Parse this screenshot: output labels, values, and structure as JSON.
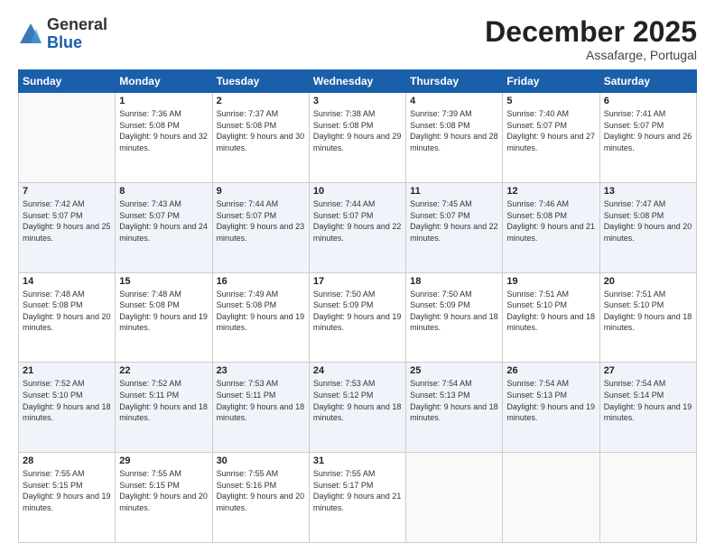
{
  "logo": {
    "general": "General",
    "blue": "Blue"
  },
  "header": {
    "month": "December 2025",
    "location": "Assafarge, Portugal"
  },
  "days_of_week": [
    "Sunday",
    "Monday",
    "Tuesday",
    "Wednesday",
    "Thursday",
    "Friday",
    "Saturday"
  ],
  "weeks": [
    [
      {
        "day": "",
        "sunrise": "",
        "sunset": "",
        "daylight": ""
      },
      {
        "day": "1",
        "sunrise": "Sunrise: 7:36 AM",
        "sunset": "Sunset: 5:08 PM",
        "daylight": "Daylight: 9 hours and 32 minutes."
      },
      {
        "day": "2",
        "sunrise": "Sunrise: 7:37 AM",
        "sunset": "Sunset: 5:08 PM",
        "daylight": "Daylight: 9 hours and 30 minutes."
      },
      {
        "day": "3",
        "sunrise": "Sunrise: 7:38 AM",
        "sunset": "Sunset: 5:08 PM",
        "daylight": "Daylight: 9 hours and 29 minutes."
      },
      {
        "day": "4",
        "sunrise": "Sunrise: 7:39 AM",
        "sunset": "Sunset: 5:08 PM",
        "daylight": "Daylight: 9 hours and 28 minutes."
      },
      {
        "day": "5",
        "sunrise": "Sunrise: 7:40 AM",
        "sunset": "Sunset: 5:07 PM",
        "daylight": "Daylight: 9 hours and 27 minutes."
      },
      {
        "day": "6",
        "sunrise": "Sunrise: 7:41 AM",
        "sunset": "Sunset: 5:07 PM",
        "daylight": "Daylight: 9 hours and 26 minutes."
      }
    ],
    [
      {
        "day": "7",
        "sunrise": "Sunrise: 7:42 AM",
        "sunset": "Sunset: 5:07 PM",
        "daylight": "Daylight: 9 hours and 25 minutes."
      },
      {
        "day": "8",
        "sunrise": "Sunrise: 7:43 AM",
        "sunset": "Sunset: 5:07 PM",
        "daylight": "Daylight: 9 hours and 24 minutes."
      },
      {
        "day": "9",
        "sunrise": "Sunrise: 7:44 AM",
        "sunset": "Sunset: 5:07 PM",
        "daylight": "Daylight: 9 hours and 23 minutes."
      },
      {
        "day": "10",
        "sunrise": "Sunrise: 7:44 AM",
        "sunset": "Sunset: 5:07 PM",
        "daylight": "Daylight: 9 hours and 22 minutes."
      },
      {
        "day": "11",
        "sunrise": "Sunrise: 7:45 AM",
        "sunset": "Sunset: 5:07 PM",
        "daylight": "Daylight: 9 hours and 22 minutes."
      },
      {
        "day": "12",
        "sunrise": "Sunrise: 7:46 AM",
        "sunset": "Sunset: 5:08 PM",
        "daylight": "Daylight: 9 hours and 21 minutes."
      },
      {
        "day": "13",
        "sunrise": "Sunrise: 7:47 AM",
        "sunset": "Sunset: 5:08 PM",
        "daylight": "Daylight: 9 hours and 20 minutes."
      }
    ],
    [
      {
        "day": "14",
        "sunrise": "Sunrise: 7:48 AM",
        "sunset": "Sunset: 5:08 PM",
        "daylight": "Daylight: 9 hours and 20 minutes."
      },
      {
        "day": "15",
        "sunrise": "Sunrise: 7:48 AM",
        "sunset": "Sunset: 5:08 PM",
        "daylight": "Daylight: 9 hours and 19 minutes."
      },
      {
        "day": "16",
        "sunrise": "Sunrise: 7:49 AM",
        "sunset": "Sunset: 5:08 PM",
        "daylight": "Daylight: 9 hours and 19 minutes."
      },
      {
        "day": "17",
        "sunrise": "Sunrise: 7:50 AM",
        "sunset": "Sunset: 5:09 PM",
        "daylight": "Daylight: 9 hours and 19 minutes."
      },
      {
        "day": "18",
        "sunrise": "Sunrise: 7:50 AM",
        "sunset": "Sunset: 5:09 PM",
        "daylight": "Daylight: 9 hours and 18 minutes."
      },
      {
        "day": "19",
        "sunrise": "Sunrise: 7:51 AM",
        "sunset": "Sunset: 5:10 PM",
        "daylight": "Daylight: 9 hours and 18 minutes."
      },
      {
        "day": "20",
        "sunrise": "Sunrise: 7:51 AM",
        "sunset": "Sunset: 5:10 PM",
        "daylight": "Daylight: 9 hours and 18 minutes."
      }
    ],
    [
      {
        "day": "21",
        "sunrise": "Sunrise: 7:52 AM",
        "sunset": "Sunset: 5:10 PM",
        "daylight": "Daylight: 9 hours and 18 minutes."
      },
      {
        "day": "22",
        "sunrise": "Sunrise: 7:52 AM",
        "sunset": "Sunset: 5:11 PM",
        "daylight": "Daylight: 9 hours and 18 minutes."
      },
      {
        "day": "23",
        "sunrise": "Sunrise: 7:53 AM",
        "sunset": "Sunset: 5:11 PM",
        "daylight": "Daylight: 9 hours and 18 minutes."
      },
      {
        "day": "24",
        "sunrise": "Sunrise: 7:53 AM",
        "sunset": "Sunset: 5:12 PM",
        "daylight": "Daylight: 9 hours and 18 minutes."
      },
      {
        "day": "25",
        "sunrise": "Sunrise: 7:54 AM",
        "sunset": "Sunset: 5:13 PM",
        "daylight": "Daylight: 9 hours and 18 minutes."
      },
      {
        "day": "26",
        "sunrise": "Sunrise: 7:54 AM",
        "sunset": "Sunset: 5:13 PM",
        "daylight": "Daylight: 9 hours and 19 minutes."
      },
      {
        "day": "27",
        "sunrise": "Sunrise: 7:54 AM",
        "sunset": "Sunset: 5:14 PM",
        "daylight": "Daylight: 9 hours and 19 minutes."
      }
    ],
    [
      {
        "day": "28",
        "sunrise": "Sunrise: 7:55 AM",
        "sunset": "Sunset: 5:15 PM",
        "daylight": "Daylight: 9 hours and 19 minutes."
      },
      {
        "day": "29",
        "sunrise": "Sunrise: 7:55 AM",
        "sunset": "Sunset: 5:15 PM",
        "daylight": "Daylight: 9 hours and 20 minutes."
      },
      {
        "day": "30",
        "sunrise": "Sunrise: 7:55 AM",
        "sunset": "Sunset: 5:16 PM",
        "daylight": "Daylight: 9 hours and 20 minutes."
      },
      {
        "day": "31",
        "sunrise": "Sunrise: 7:55 AM",
        "sunset": "Sunset: 5:17 PM",
        "daylight": "Daylight: 9 hours and 21 minutes."
      },
      {
        "day": "",
        "sunrise": "",
        "sunset": "",
        "daylight": ""
      },
      {
        "day": "",
        "sunrise": "",
        "sunset": "",
        "daylight": ""
      },
      {
        "day": "",
        "sunrise": "",
        "sunset": "",
        "daylight": ""
      }
    ]
  ]
}
